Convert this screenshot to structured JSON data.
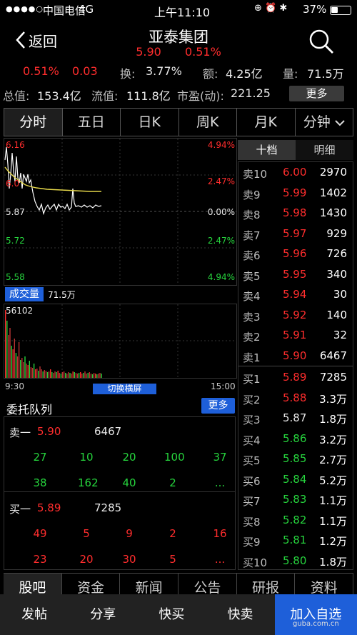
{
  "status": {
    "carrier": "中国电信",
    "network": "4G",
    "time": "上午11:10",
    "battery": "37%",
    "battery_level": 0.37
  },
  "nav": {
    "back_label": "返回",
    "stock_name": "亚泰集团",
    "price": "5.90",
    "change_pct": "0.51%"
  },
  "quote": {
    "pct": "0.51%",
    "chg": "0.03",
    "turnover_label": "换:",
    "turnover": "3.77%",
    "amount_label": "额:",
    "amount": "4.25亿",
    "volume_label": "量:",
    "volume": "71.5万",
    "total_label": "总值:",
    "total": "153.4亿",
    "float_label": "流值:",
    "float": "111.8亿",
    "pe_label": "市盈(动):",
    "pe": "221.25",
    "more": "更多"
  },
  "tabs": [
    "分时",
    "五日",
    "日K",
    "周K",
    "月K",
    "分钟"
  ],
  "chart": {
    "left_labels": [
      "6.16",
      "6.0",
      "5.87",
      "5.72",
      "5.58"
    ],
    "right_labels": [
      "4.94%",
      "2.47%",
      "0.00%",
      "2.47%",
      "4.94%"
    ],
    "vol_tag": "成交量",
    "vol_value": "71.5万",
    "vol_max": "56102",
    "time_start": "9:30",
    "time_end": "15:00",
    "switch_label": "切换横屏"
  },
  "queue": {
    "title": "委托队列",
    "more": "更多",
    "sell_label": "卖一",
    "sell_price": "5.90",
    "sell_total": "6467",
    "sell_rows": [
      [
        "27",
        "10",
        "20",
        "100",
        "37"
      ],
      [
        "38",
        "162",
        "40",
        "2",
        "..."
      ]
    ],
    "buy_label": "买一",
    "buy_price": "5.89",
    "buy_total": "7285",
    "buy_rows": [
      [
        "49",
        "5",
        "9",
        "2",
        "16"
      ],
      [
        "23",
        "20",
        "30",
        "5",
        "..."
      ]
    ]
  },
  "book": {
    "tab_active": "十档",
    "tab_other": "明细",
    "sells": [
      {
        "label": "卖10",
        "price": "6.00",
        "vol": "2970",
        "color": "red"
      },
      {
        "label": "卖9",
        "price": "5.99",
        "vol": "1402",
        "color": "red"
      },
      {
        "label": "卖8",
        "price": "5.98",
        "vol": "1430",
        "color": "red"
      },
      {
        "label": "卖7",
        "price": "5.97",
        "vol": "929",
        "color": "red"
      },
      {
        "label": "卖6",
        "price": "5.96",
        "vol": "726",
        "color": "red"
      },
      {
        "label": "卖5",
        "price": "5.95",
        "vol": "340",
        "color": "red"
      },
      {
        "label": "卖4",
        "price": "5.94",
        "vol": "30",
        "color": "red"
      },
      {
        "label": "卖3",
        "price": "5.92",
        "vol": "140",
        "color": "red"
      },
      {
        "label": "卖2",
        "price": "5.91",
        "vol": "32",
        "color": "red"
      },
      {
        "label": "卖1",
        "price": "5.90",
        "vol": "6467",
        "color": "red"
      }
    ],
    "buys": [
      {
        "label": "买1",
        "price": "5.89",
        "vol": "7285",
        "color": "red"
      },
      {
        "label": "买2",
        "price": "5.88",
        "vol": "3.3万",
        "color": "red"
      },
      {
        "label": "买3",
        "price": "5.87",
        "vol": "1.8万",
        "color": "white"
      },
      {
        "label": "买4",
        "price": "5.86",
        "vol": "3.2万",
        "color": "green"
      },
      {
        "label": "买5",
        "price": "5.85",
        "vol": "2.7万",
        "color": "green"
      },
      {
        "label": "买6",
        "price": "5.84",
        "vol": "5.2万",
        "color": "green"
      },
      {
        "label": "买7",
        "price": "5.83",
        "vol": "1.1万",
        "color": "green"
      },
      {
        "label": "买8",
        "price": "5.82",
        "vol": "1.1万",
        "color": "green"
      },
      {
        "label": "买9",
        "price": "5.81",
        "vol": "1.2万",
        "color": "green"
      },
      {
        "label": "买10",
        "price": "5.80",
        "vol": "1.8万",
        "color": "green"
      }
    ]
  },
  "bottom_tabs": [
    "股吧",
    "资金",
    "新闻",
    "公告",
    "研报",
    "资料"
  ],
  "actions": [
    "发帖",
    "分享",
    "快买",
    "快卖",
    "加入自选"
  ],
  "watermark": "guba.com.cn",
  "colors": {
    "red": "#ff2d2d",
    "green": "#26d43d",
    "accent": "#1e5fd9"
  }
}
